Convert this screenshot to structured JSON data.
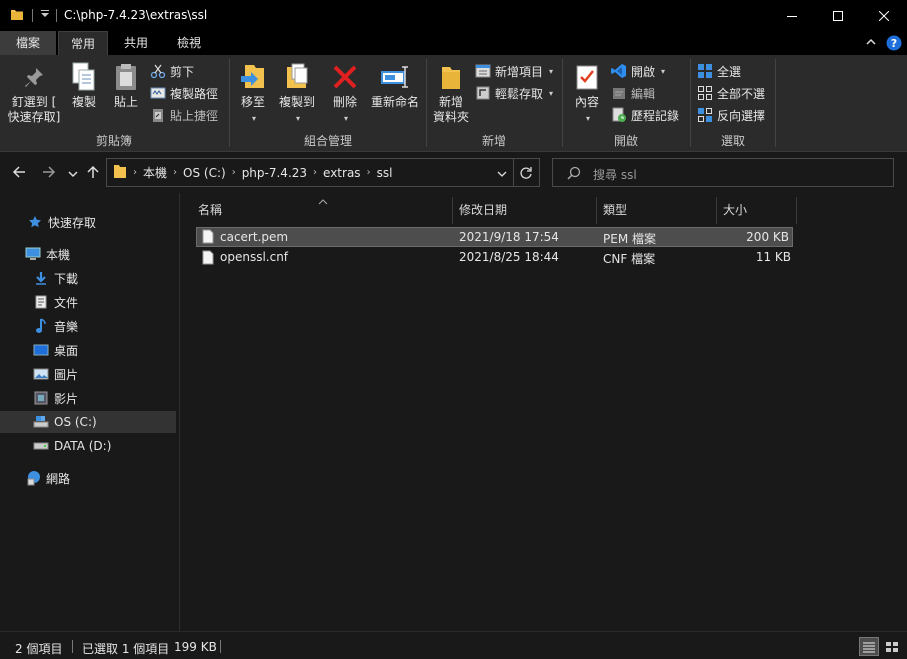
{
  "window": {
    "title": "C:\\php-7.4.23\\extras\\ssl",
    "controls": {
      "minimize_icon": "minimize-icon",
      "maximize_icon": "maximize-icon",
      "close_icon": "close-icon"
    }
  },
  "ribbon_tabs": [
    {
      "label": "檔案"
    },
    {
      "label": "常用"
    },
    {
      "label": "共用"
    },
    {
      "label": "檢視"
    }
  ],
  "ribbon": {
    "clipboard": {
      "label": "剪貼簿",
      "pin": "釘選到 [\n快速存取]",
      "copy": "複製",
      "paste": "貼上",
      "cut": "剪下",
      "copy_path": "複製路徑",
      "paste_shortcut": "貼上捷徑"
    },
    "organize": {
      "label": "組合管理",
      "move_to": "移至",
      "copy_to": "複製到",
      "delete": "刪除",
      "rename": "重新命名"
    },
    "new": {
      "label": "新增",
      "new_folder": "新增\n資料夾",
      "new_item": "新增項目",
      "easy_access": "輕鬆存取"
    },
    "open": {
      "label": "開啟",
      "properties": "內容",
      "open": "開啟",
      "edit": "編輯",
      "history": "歷程記錄"
    },
    "select": {
      "label": "選取",
      "select_all": "全選",
      "select_none": "全部不選",
      "invert": "反向選擇"
    }
  },
  "address": {
    "crumbs": [
      "本機",
      "OS (C:)",
      "php-7.4.23",
      "extras",
      "ssl"
    ],
    "search_placeholder": "搜尋 ssl"
  },
  "nav_pane": {
    "quick_access": "快速存取",
    "this_pc": "本機",
    "items": [
      {
        "label": "下載",
        "icon": "download-icon"
      },
      {
        "label": "文件",
        "icon": "document-icon"
      },
      {
        "label": "音樂",
        "icon": "music-icon"
      },
      {
        "label": "桌面",
        "icon": "desktop-icon"
      },
      {
        "label": "圖片",
        "icon": "pictures-icon"
      },
      {
        "label": "影片",
        "icon": "videos-icon"
      },
      {
        "label": "OS (C:)",
        "icon": "drive-c-icon"
      },
      {
        "label": "DATA (D:)",
        "icon": "drive-d-icon"
      }
    ],
    "network": "網路"
  },
  "file_list": {
    "columns": {
      "name": "名稱",
      "modified": "修改日期",
      "type": "類型",
      "size": "大小"
    },
    "rows": [
      {
        "name": "cacert.pem",
        "modified": "2021/9/18 17:54",
        "type": "PEM 檔案",
        "size": "200 KB",
        "selected": true
      },
      {
        "name": "openssl.cnf",
        "modified": "2021/8/25 18:44",
        "type": "CNF 檔案",
        "size": "11 KB",
        "selected": false
      }
    ]
  },
  "status": {
    "item_count": "2 個項目",
    "selected": "已選取 1 個項目",
    "selected_size": "199 KB"
  }
}
